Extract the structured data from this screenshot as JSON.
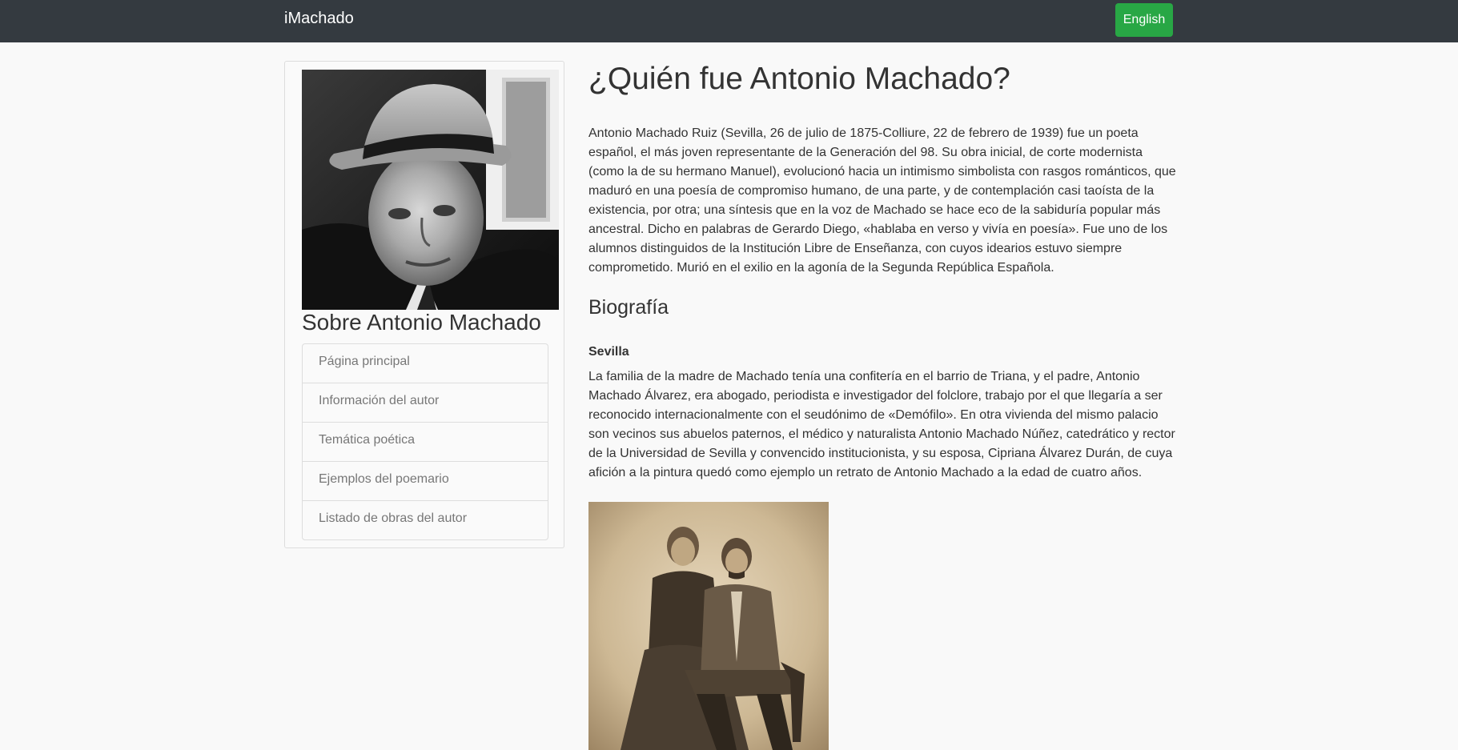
{
  "navbar": {
    "brand": "iMachado",
    "language_button": "English"
  },
  "sidebar": {
    "title": "Sobre Antonio Machado",
    "items": [
      {
        "label": "Página principal"
      },
      {
        "label": "Información del autor"
      },
      {
        "label": "Temática poética"
      },
      {
        "label": "Ejemplos del poemario"
      },
      {
        "label": "Listado de obras del autor"
      }
    ]
  },
  "main": {
    "title": "¿Quién fue Antonio Machado?",
    "intro": "Antonio Machado Ruiz (Sevilla, 26 de julio de 1875-Colliure, 22 de febrero de 1939) fue un poeta español, el más joven representante de la Generación del 98. Su obra inicial, de corte modernista (como la de su hermano Manuel), evolucionó hacia un intimismo simbolista con rasgos románticos, que maduró en una poesía de compromiso humano, de una parte, y de contemplación casi taoísta de la existencia, por otra; una síntesis que en la voz de Machado se hace eco de la sabiduría popular más ancestral. Dicho en palabras de Gerardo Diego, «hablaba en verso y vivía en poesía». Fue uno de los alumnos distinguidos de la Institución Libre de Enseñanza, con cuyos idearios estuvo siempre comprometido. Murió en el exilio en la agonía de la Segunda República Española.",
    "biography_heading": "Biografía",
    "section_heading": "Sevilla",
    "section_text": "La familia de la madre de Machado tenía una confitería en el barrio de Triana, y el padre, Antonio Machado Álvarez, era abogado, periodista e investigador del folclore, trabajo por el que llegaría a ser reconocido internacionalmente con el seudónimo de «Demófilo». En otra vivienda del mismo palacio son vecinos sus abuelos paternos, el médico y naturalista Antonio Machado Núñez, catedrático y rector de la Universidad de Sevilla y convencido institucionista, y su esposa, Cipriana Álvarez Durán, de cuya afición a la pintura quedó como ejemplo un retrato de Antonio Machado a la edad de cuatro años."
  }
}
